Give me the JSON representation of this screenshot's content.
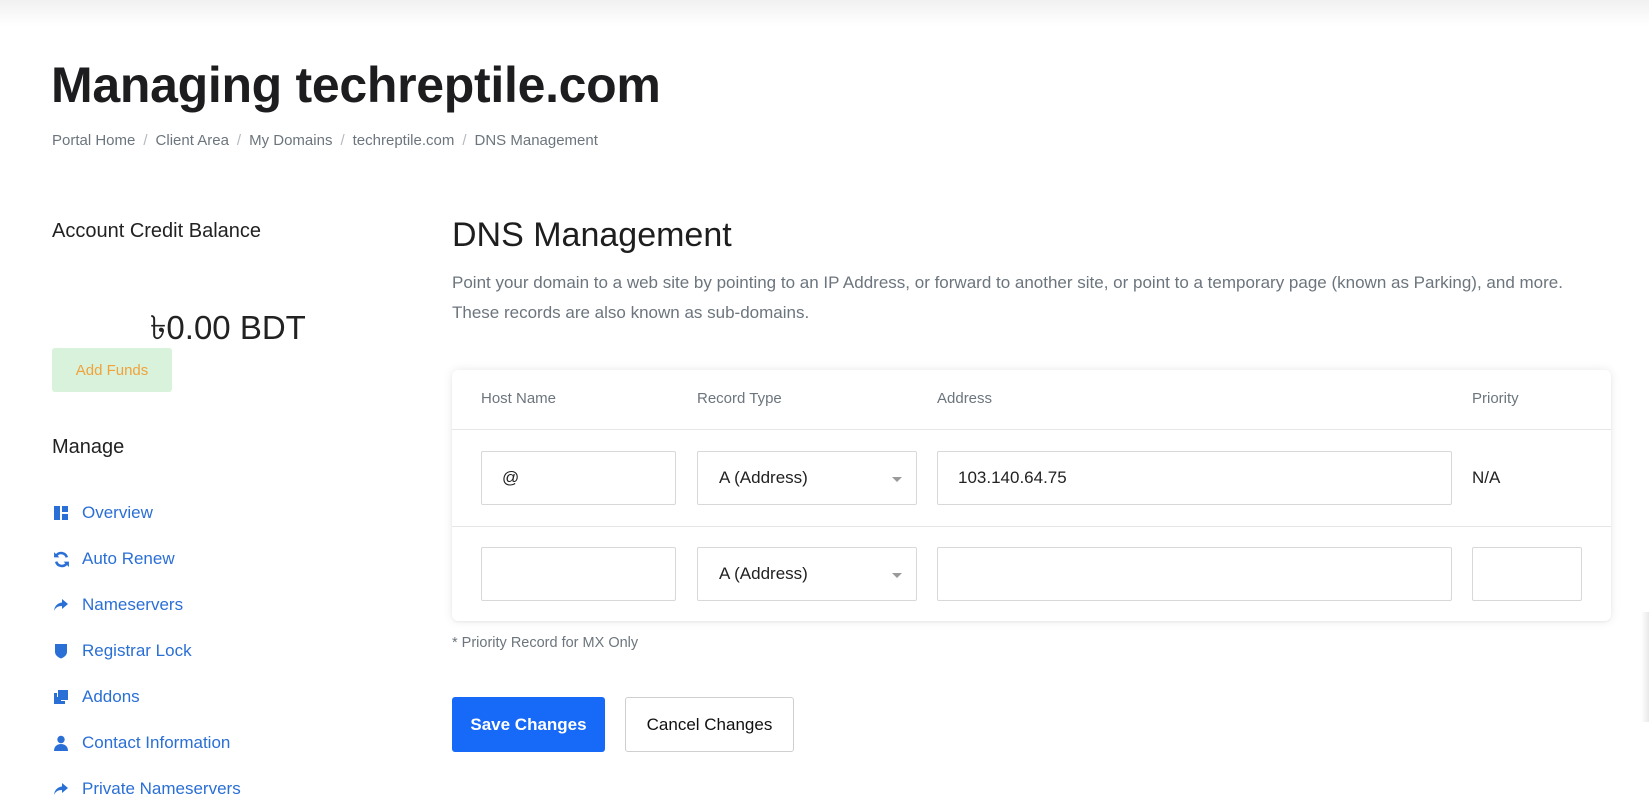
{
  "page": {
    "title": "Managing techreptile.com"
  },
  "breadcrumb": [
    {
      "label": "Portal Home"
    },
    {
      "label": "Client Area"
    },
    {
      "label": "My Domains"
    },
    {
      "label": "techreptile.com"
    },
    {
      "label": "DNS Management"
    }
  ],
  "breadcrumb_separator": "/",
  "sidebar": {
    "credit_heading": "Account Credit Balance",
    "credit_amount": "৳0.00 BDT",
    "add_funds_label": "Add Funds",
    "manage_heading": "Manage",
    "items": [
      {
        "label": "Overview",
        "icon": "dashboard-icon"
      },
      {
        "label": "Auto Renew",
        "icon": "sync-icon"
      },
      {
        "label": "Nameservers",
        "icon": "share-arrow-icon"
      },
      {
        "label": "Registrar Lock",
        "icon": "shield-icon"
      },
      {
        "label": "Addons",
        "icon": "addons-icon"
      },
      {
        "label": "Contact Information",
        "icon": "user-icon"
      },
      {
        "label": "Private Nameservers",
        "icon": "share-arrow-icon"
      }
    ]
  },
  "main": {
    "title": "DNS Management",
    "description": "Point your domain to a web site by pointing to an IP Address, or forward to another site, or point to a temporary page (known as Parking), and more. These records are also known as sub-domains.",
    "table": {
      "headers": {
        "host": "Host Name",
        "type": "Record Type",
        "address": "Address",
        "priority": "Priority"
      },
      "rows": [
        {
          "host": "@",
          "type": "A (Address)",
          "address": "103.140.64.75",
          "priority": "N/A"
        },
        {
          "host": "",
          "type": "A (Address)",
          "address": "",
          "priority": ""
        }
      ]
    },
    "note": "* Priority Record for MX Only",
    "save_label": "Save Changes",
    "cancel_label": "Cancel Changes"
  },
  "colors": {
    "link": "#2a6fd6",
    "primary_button": "#1769f7",
    "add_funds_bg": "#d8f2dc",
    "add_funds_text": "#f0a23b"
  }
}
